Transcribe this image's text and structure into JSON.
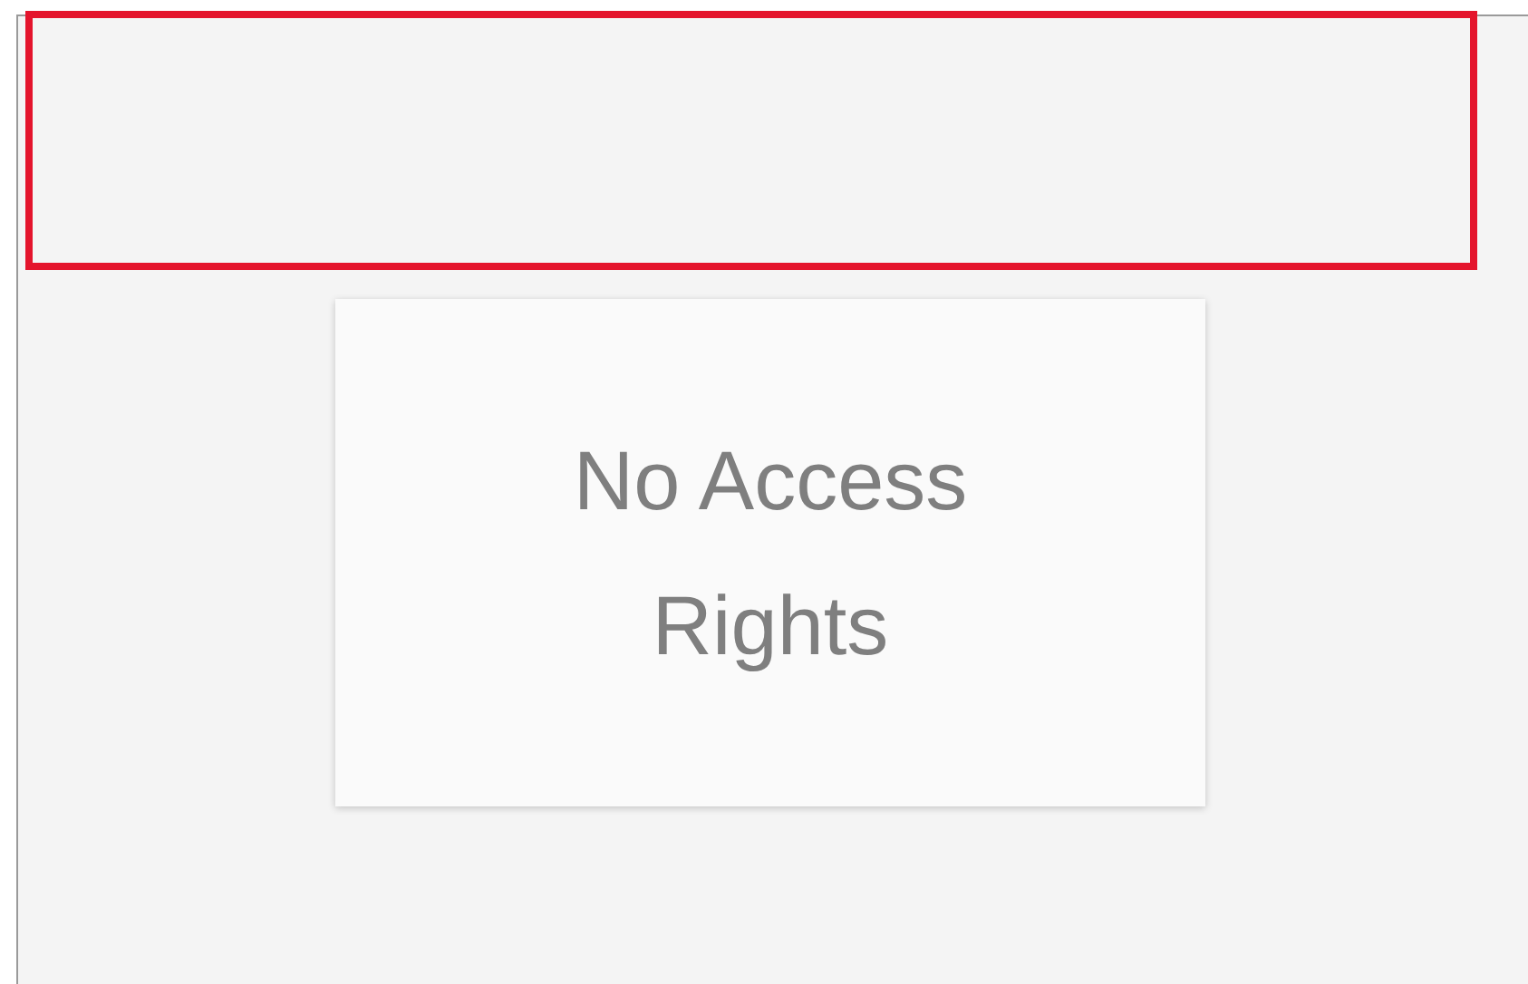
{
  "message_card": {
    "text": "No Access Rights"
  }
}
